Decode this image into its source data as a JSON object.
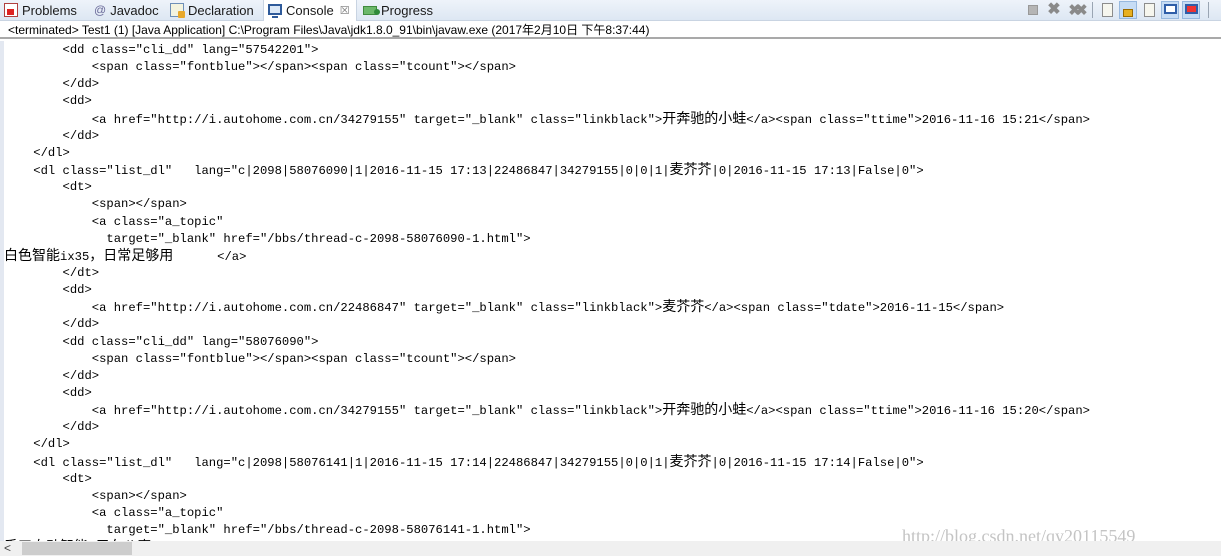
{
  "tabs": [
    {
      "label": "Problems",
      "icon": "problems-icon"
    },
    {
      "label": "Javadoc",
      "icon": "at-icon",
      "glyph": "@"
    },
    {
      "label": "Declaration",
      "icon": "declaration-icon"
    },
    {
      "label": "Console",
      "icon": "console-icon",
      "active": true,
      "close_glyph": "☒"
    },
    {
      "label": "Progress",
      "icon": "progress-icon"
    }
  ],
  "toolbar": {
    "buttons": [
      "terminate",
      "remove-launch",
      "remove-all-terminated",
      "clear-console",
      "scroll-lock",
      "word-wrap",
      "show-console-on-stdout",
      "show-console-on-stderr"
    ],
    "x_glyph": "✖",
    "xx_glyph": "✖✖"
  },
  "status": {
    "text": "<terminated> Test1 (1) [Java Application] C:\\Program Files\\Java\\jdk1.8.0_91\\bin\\javaw.exe (2017年2月10日 下午8:37:44)"
  },
  "console": {
    "lines": [
      "        <dd class=\"cli_dd\" lang=\"57542201\">",
      "            <span class=\"fontblue\"></span><span class=\"tcount\"></span>",
      "        </dd>",
      "        <dd>",
      "            <a href=\"http://i.autohome.com.cn/34279155\" target=\"_blank\" class=\"linkblack\">开奔驰的小蛙</a><span class=\"ttime\">2016-11-16 15:21</span>",
      "        </dd>",
      "    </dl>",
      "    <dl class=\"list_dl\"   lang=\"c|2098|58076090|1|2016-11-15 17:13|22486847|34279155|0|0|1|麦芥芥|0|2016-11-15 17:13|False|0\">",
      "        <dt>",
      "            <span></span>",
      "            <a class=\"a_topic\"",
      "              target=\"_blank\" href=\"/bbs/thread-c-2098-58076090-1.html\">",
      "白色智能ix35，日常足够用      </a>",
      "        </dt>",
      "        <dd>",
      "            <a href=\"http://i.autohome.com.cn/22486847\" target=\"_blank\" class=\"linkblack\">麦芥芥</a><span class=\"tdate\">2016-11-15</span>",
      "        </dd>",
      "        <dd class=\"cli_dd\" lang=\"58076090\">",
      "            <span class=\"fontblue\"></span><span class=\"tcount\"></span>",
      "        </dd>",
      "        <dd>",
      "            <a href=\"http://i.autohome.com.cn/34279155\" target=\"_blank\" class=\"linkblack\">开奔驰的小蛙</a><span class=\"ttime\">2016-11-16 15:20</span>",
      "        </dd>",
      "    </dl>",
      "    <dl class=\"list_dl\"   lang=\"c|2098|58076141|1|2016-11-15 17:14|22486847|34279155|0|0|1|麦芥芥|0|2016-11-15 17:14|False|0\">",
      "        <dt>",
      "            <span></span>",
      "            <a class=\"a_topic\"",
      "              target=\"_blank\" href=\"/bbs/thread-c-2098-58076141-1.html\">",
      "手工自动智能 用车八真      </a>"
    ]
  },
  "scrollbar": {
    "left_arrow": "<"
  },
  "watermark": "http://blog.csdn.net/qy20115549"
}
